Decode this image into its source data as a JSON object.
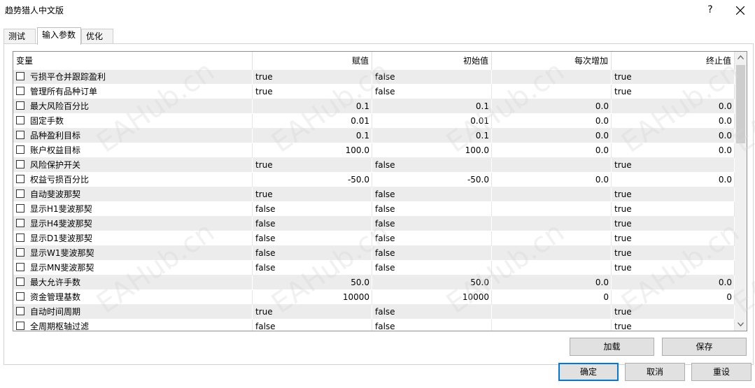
{
  "window": {
    "title": "趋势猎人中文版",
    "help": "?"
  },
  "tabs": [
    {
      "label": "测试",
      "active": false
    },
    {
      "label": "输入参数",
      "active": true
    },
    {
      "label": "优化",
      "active": false
    }
  ],
  "table": {
    "headers": [
      "变量",
      "赋值",
      "初始值",
      "每次增加",
      "终止值"
    ],
    "rows": [
      {
        "name": "亏损平仓并跟踪盈利",
        "value": "true",
        "start": "false",
        "step": "",
        "stop": "true",
        "numeric": false
      },
      {
        "name": "管理所有品种订单",
        "value": "true",
        "start": "false",
        "step": "",
        "stop": "true",
        "numeric": false
      },
      {
        "name": "最大风险百分比",
        "value": "0.1",
        "start": "0.1",
        "step": "0.0",
        "stop": "0.0",
        "numeric": true
      },
      {
        "name": "固定手数",
        "value": "0.01",
        "start": "0.01",
        "step": "0.0",
        "stop": "0.0",
        "numeric": true
      },
      {
        "name": "品种盈利目标",
        "value": "0.1",
        "start": "0.1",
        "step": "0.0",
        "stop": "0.0",
        "numeric": true
      },
      {
        "name": "账户权益目标",
        "value": "100.0",
        "start": "100.0",
        "step": "0.0",
        "stop": "0.0",
        "numeric": true
      },
      {
        "name": "风险保护开关",
        "value": "true",
        "start": "false",
        "step": "",
        "stop": "true",
        "numeric": false
      },
      {
        "name": "权益亏损百分比",
        "value": "-50.0",
        "start": "-50.0",
        "step": "0.0",
        "stop": "0.0",
        "numeric": true
      },
      {
        "name": "自动斐波那契",
        "value": "true",
        "start": "false",
        "step": "",
        "stop": "true",
        "numeric": false
      },
      {
        "name": "显示H1斐波那契",
        "value": "false",
        "start": "false",
        "step": "",
        "stop": "true",
        "numeric": false
      },
      {
        "name": "显示H4斐波那契",
        "value": "false",
        "start": "false",
        "step": "",
        "stop": "true",
        "numeric": false
      },
      {
        "name": "显示D1斐波那契",
        "value": "false",
        "start": "false",
        "step": "",
        "stop": "true",
        "numeric": false
      },
      {
        "name": "显示W1斐波那契",
        "value": "false",
        "start": "false",
        "step": "",
        "stop": "true",
        "numeric": false
      },
      {
        "name": "显示MN斐波那契",
        "value": "false",
        "start": "false",
        "step": "",
        "stop": "true",
        "numeric": false
      },
      {
        "name": "最大允许手数",
        "value": "50.0",
        "start": "50.0",
        "step": "0.0",
        "stop": "0.0",
        "numeric": true
      },
      {
        "name": "资金管理基数",
        "value": "10000",
        "start": "10000",
        "step": "0",
        "stop": "0",
        "numeric": true
      },
      {
        "name": "自动时间周期",
        "value": "true",
        "start": "false",
        "step": "",
        "stop": "true",
        "numeric": false
      },
      {
        "name": "全周期枢轴过滤",
        "value": "false",
        "start": "false",
        "step": "",
        "stop": "true",
        "numeric": false
      }
    ]
  },
  "buttons": {
    "load": "加载",
    "save": "保存",
    "ok": "确定",
    "cancel": "取消",
    "reset": "重设"
  },
  "watermark": {
    "text": "EAHub.cn"
  }
}
